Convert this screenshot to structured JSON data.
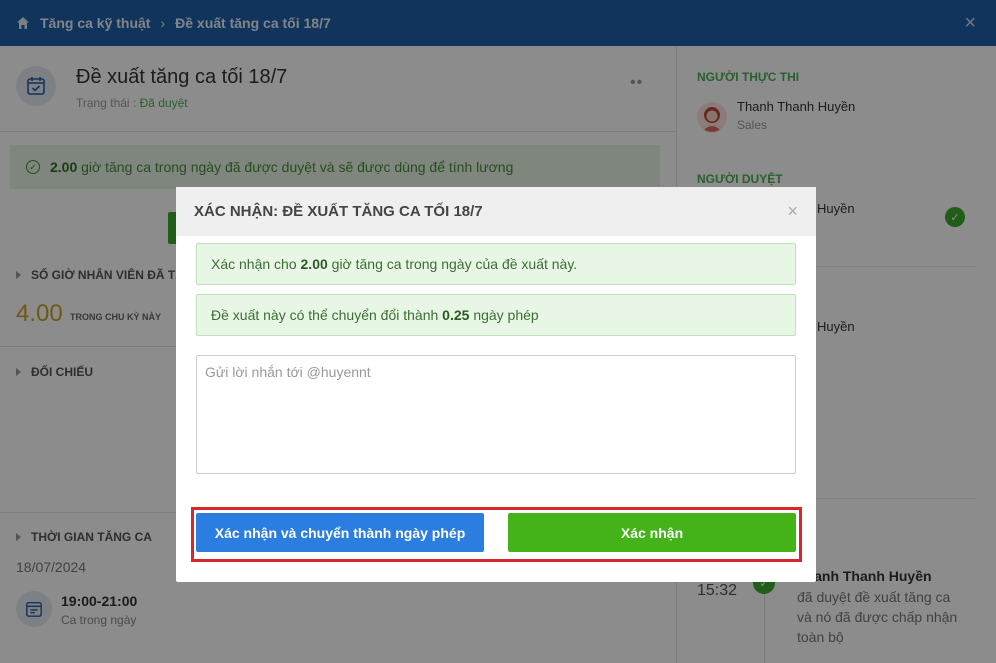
{
  "breadcrumb": {
    "root": "Tăng ca kỹ thuật",
    "current": "Đề xuất tăng ca tối 18/7"
  },
  "proposal": {
    "title": "Đề xuất tăng ca tối 18/7",
    "status_label": "Trạng thái :",
    "status_value": "Đã duyệt"
  },
  "banner": {
    "hours": "2.00",
    "text": "giờ tăng ca trong ngày đã được duyệt và sẽ được dùng để tính lương"
  },
  "sections": {
    "hours_title": "SỐ GIỜ NHÂN VIÊN ĐÃ TĂNG",
    "hours_value": "4.00",
    "hours_sub": "TRONG CHU KỲ NÀY",
    "reconcile_title": "ĐỐI CHIẾU",
    "time_title": "THỜI GIAN TĂNG CA",
    "date": "18/07/2024",
    "shift_time": "19:00-21:00",
    "shift_type": "Ca trong ngày"
  },
  "sidebar": {
    "executor_label": "NGƯỜI THỰC THI",
    "executor_name": "Thanh Thanh Huyền",
    "executor_role": "Sales",
    "approver_label": "NGƯỜI DUYỆT",
    "approver1_name": "Huyền",
    "approver2_name": "Huyền",
    "log_time": "15:32",
    "log_name": "Thanh Thanh Huyền",
    "log_text": "đã duyệt đề xuất tăng ca và nó đã được chấp nhận toàn bộ"
  },
  "modal": {
    "title": "XÁC NHẬN: ĐỀ XUẤT TĂNG CA TỐI 18/7",
    "confirm_prefix": "Xác nhận cho",
    "confirm_hours": "2.00",
    "confirm_suffix": "giờ tăng ca trong ngày của đề xuất này.",
    "convert_prefix": "Đề xuất này có thể chuyển đổi thành",
    "convert_days": "0.25",
    "convert_suffix": "ngày phép",
    "message_placeholder": "Gửi lời nhắn tới @huyennt",
    "btn_convert": "Xác nhận và chuyển thành ngày phép",
    "btn_confirm": "Xác nhận"
  },
  "colors": {
    "topbar": "#1f5fa8",
    "primary_blue": "#2b7de0",
    "success_green": "#43b319",
    "highlight_red": "#d9262c"
  }
}
